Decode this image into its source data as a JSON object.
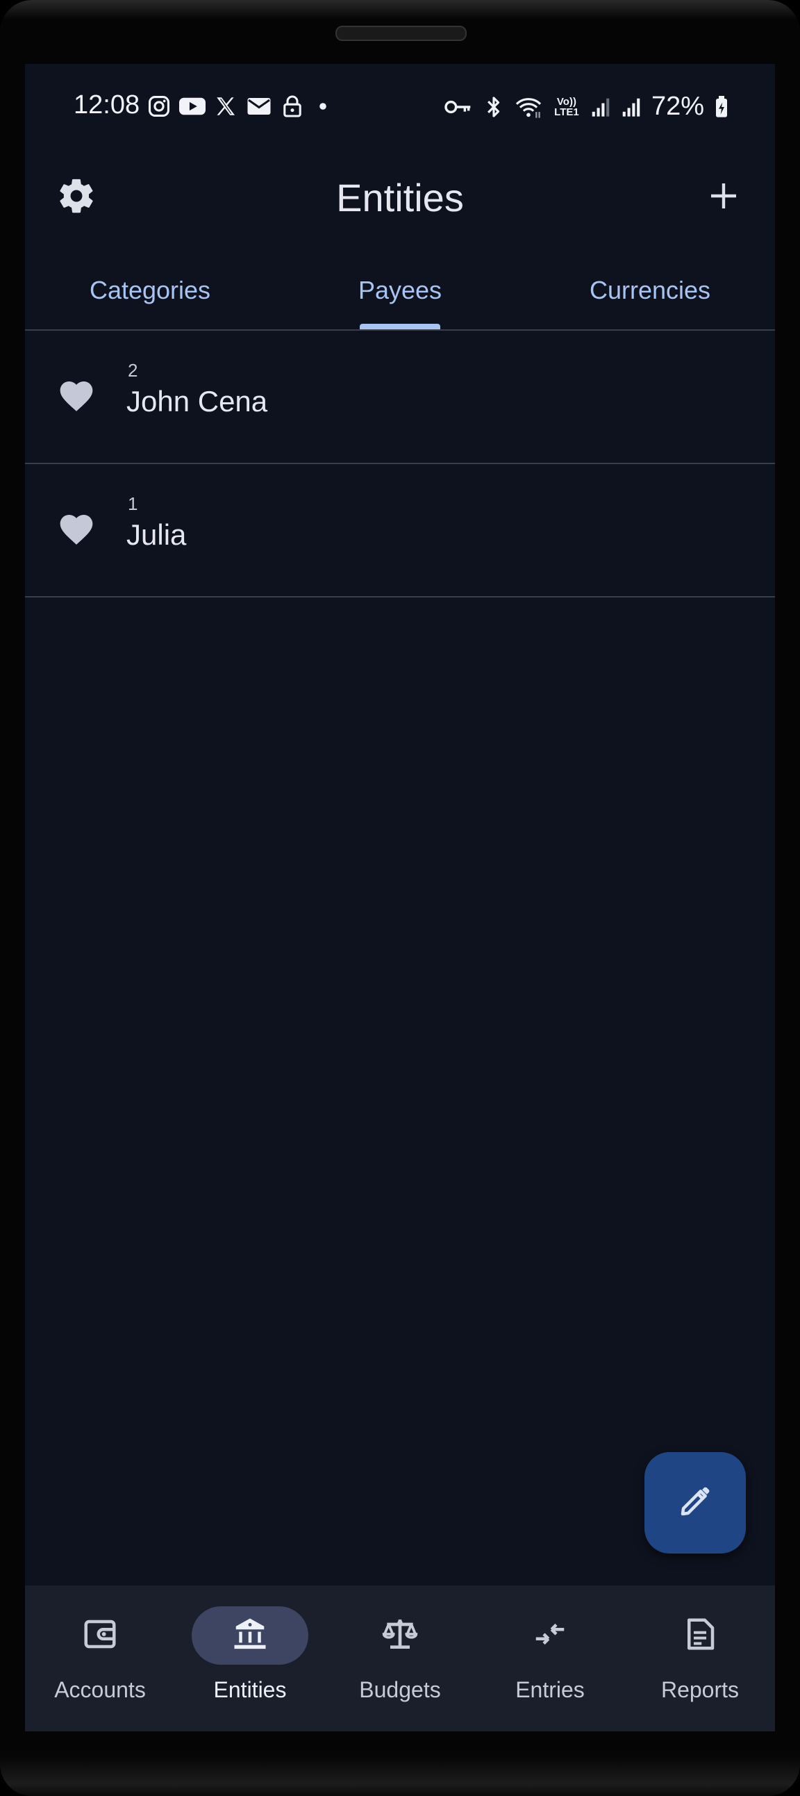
{
  "status_bar": {
    "time": "12:08",
    "battery": "72%",
    "left_icons": [
      "instagram-icon",
      "youtube-icon",
      "x-icon",
      "mail-icon",
      "lock-icon",
      "dot-icon"
    ],
    "right_icons": [
      "vpn-key-icon",
      "bluetooth-icon",
      "wifi-icon",
      "volte-icon",
      "signal-icon",
      "signal-icon",
      "battery-icon"
    ],
    "volte_text": "Vo))",
    "lte_text": "LTE1"
  },
  "header": {
    "title": "Entities"
  },
  "tabs": [
    {
      "label": "Categories",
      "active": false
    },
    {
      "label": "Payees",
      "active": true
    },
    {
      "label": "Currencies",
      "active": false
    }
  ],
  "payees": [
    {
      "count": "2",
      "name": "John Cena",
      "icon": "heart-icon"
    },
    {
      "count": "1",
      "name": "Julia",
      "icon": "heart-icon"
    }
  ],
  "fab": {
    "icon": "edit-pencil-icon"
  },
  "bottom_nav": [
    {
      "label": "Accounts",
      "icon": "wallet-icon",
      "active": false
    },
    {
      "label": "Entities",
      "icon": "bank-icon",
      "active": true
    },
    {
      "label": "Budgets",
      "icon": "scale-icon",
      "active": false
    },
    {
      "label": "Entries",
      "icon": "transfer-arrows-icon",
      "active": false
    },
    {
      "label": "Reports",
      "icon": "document-icon",
      "active": false
    }
  ],
  "colors": {
    "background": "#0e121e",
    "accent": "#a8c4f2",
    "fab": "#1f4584",
    "nav_background": "#1b1f2b",
    "nav_active_pill": "#3e4562"
  }
}
